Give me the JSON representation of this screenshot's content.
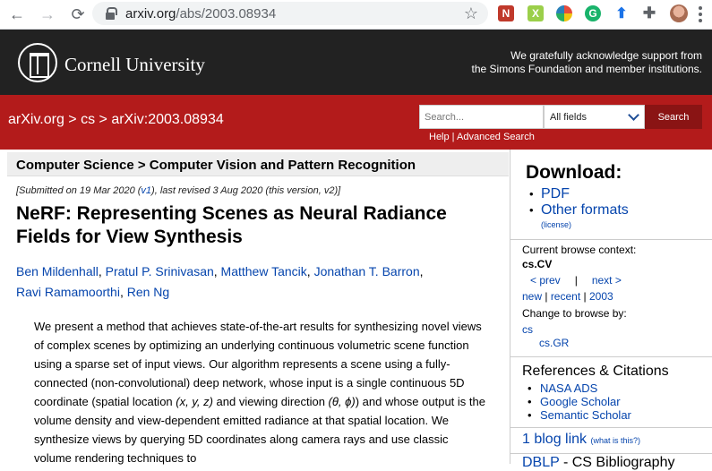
{
  "browser": {
    "url_domain": "arxiv.org",
    "url_path": "/abs/2003.08934",
    "back_icon": "←",
    "forward_icon": "→",
    "reload_icon": "⟳",
    "star_icon": "☆",
    "ext_n_label": "N",
    "ext_x_label": "X",
    "ext_g_label": "G"
  },
  "cornell": {
    "name": "Cornell University",
    "support_line1": "We gratefully acknowledge support from",
    "support_line2": "the Simons Foundation and member institutions."
  },
  "arxiv_bar": {
    "crumb_home": "arXiv.org",
    "crumb_sep": " > ",
    "crumb_cs": "cs",
    "crumb_id": "arXiv:2003.08934",
    "search_placeholder": "Search...",
    "field_selected": "All fields",
    "search_button": "Search",
    "help": "Help",
    "help_sep": " | ",
    "advanced": "Advanced Search"
  },
  "paper": {
    "subject": "Computer Science > Computer Vision and Pattern Recognition",
    "submitted_prefix": "[Submitted on 19 Mar 2020 (",
    "v1": "v1",
    "submitted_suffix": "), last revised 3 Aug 2020 (this version, v2)]",
    "title": "NeRF: Representing Scenes as Neural Radiance Fields for View Synthesis",
    "authors": [
      "Ben Mildenhall",
      "Pratul P. Srinivasan",
      "Matthew Tancik",
      "Jonathan T. Barron",
      "Ravi Ramamoorthi",
      "Ren Ng"
    ],
    "author_sep": ", ",
    "abstract_1": "We present a method that achieves state-of-the-art results for synthesizing novel views of complex scenes by optimizing an underlying continuous volumetric scene function using a sparse set of input views. Our algorithm represents a scene using a fully-connected (non-convolutional) deep network, whose input is a single continuous 5D coordinate (spatial location ",
    "abstract_math1": "(x, y, z)",
    "abstract_2": " and viewing direction ",
    "abstract_math2": "(θ, ϕ)",
    "abstract_3": ") and whose output is the volume density and view-dependent emitted radiance at that spatial location. We synthesize views by querying 5D coordinates along camera rays and use classic volume rendering techniques to"
  },
  "sidebar": {
    "download_title": "Download:",
    "pdf": "PDF",
    "other_formats": "Other formats",
    "license": "(license)",
    "context_label": "Current browse context:",
    "context_value": "cs.CV",
    "prev": "< prev",
    "nav_sep": "|",
    "next": "next >",
    "new": "new",
    "recent": "recent",
    "year": "2003",
    "bar": " | ",
    "change_label": "Change to browse by:",
    "change_cs": "cs",
    "change_gr": "cs.GR",
    "refs_title": "References & Citations",
    "refs": [
      "NASA ADS",
      "Google Scholar",
      "Semantic Scholar"
    ],
    "blog": "1 blog link",
    "whatis": "(what is this?)",
    "dblp_link": "DBLP",
    "dblp_rest": " - CS Bibliography"
  }
}
